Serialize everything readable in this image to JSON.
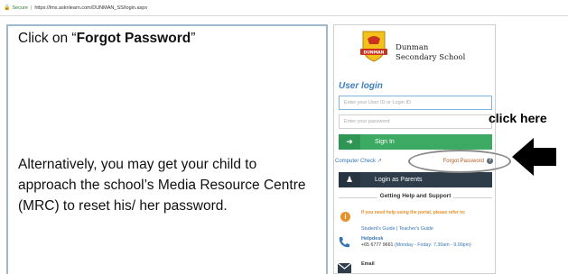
{
  "browser": {
    "secure_label": "Secure",
    "url": "https://lms.asknlearn.com/DUNMAN_SS/login.aspx"
  },
  "instruction": {
    "line1_prefix": "Click on “",
    "line1_bold": "Forgot Password",
    "line1_suffix": "”",
    "alternative": "Alternatively, you may get your child to approach the school’s Media Resource Centre (MRC) to reset his/ her password."
  },
  "portal": {
    "school_name_line1": "Dunman",
    "school_name_line2": "Secondary School",
    "logo_text": "DUNMAN",
    "user_login_heading": "User login",
    "user_id_placeholder": "Enter your User ID or Login ID",
    "password_placeholder": "Enter your password",
    "sign_in_label": "Sign In",
    "computer_check_label": "Computer Check",
    "forgot_password_label": "Forgot Password",
    "login_as_parents_label": "Login as Parents",
    "help_heading": "Getting Help and Support",
    "help_note": "If you need help using the portal, please refer to:",
    "guides": "Student's Guide | Teacher's Guide",
    "helpdesk_label": "Helpdesk",
    "helpdesk_phone": "+65 6777 9661",
    "helpdesk_hours": "(Monday - Friday: 7.30am - 9.00pm)",
    "email_label": "Email"
  },
  "annotation": {
    "click_here": "click here"
  },
  "colors": {
    "green_button": "#3daa63",
    "dark_button": "#2f3d4a",
    "link_blue": "#3576b4",
    "orange": "#e8902a"
  }
}
